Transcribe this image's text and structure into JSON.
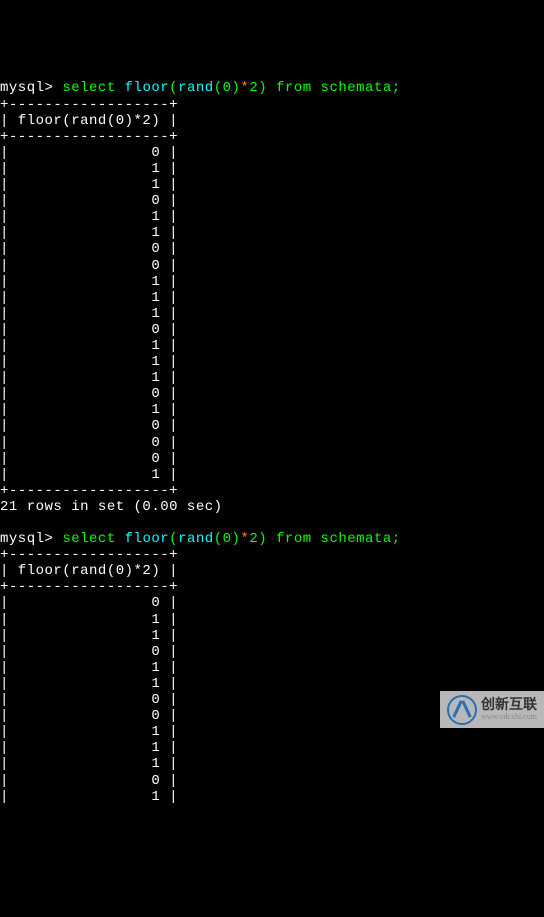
{
  "query1": {
    "prompt": "mysql>",
    "sql_select": "select",
    "sql_floor": "floor",
    "sql_rand": "rand",
    "sql_zero": "0",
    "sql_two": "2",
    "sql_from": "from",
    "sql_table": "schemata",
    "border": "+------------------+",
    "header": "| floor(rand(0)*2) |",
    "rows": [
      "|                0 |",
      "|                1 |",
      "|                1 |",
      "|                0 |",
      "|                1 |",
      "|                1 |",
      "|                0 |",
      "|                0 |",
      "|                1 |",
      "|                1 |",
      "|                1 |",
      "|                0 |",
      "|                1 |",
      "|                1 |",
      "|                1 |",
      "|                0 |",
      "|                1 |",
      "|                0 |",
      "|                0 |",
      "|                0 |",
      "|                1 |"
    ],
    "status": "21 rows in set (0.00 sec)"
  },
  "query2": {
    "prompt": "mysql>",
    "sql_select": "select",
    "sql_floor": "floor",
    "sql_rand": "rand",
    "sql_zero": "0",
    "sql_two": "2",
    "sql_from": "from",
    "sql_table": "schemata",
    "border": "+------------------+",
    "header": "| floor(rand(0)*2) |",
    "rows": [
      "|                0 |",
      "|                1 |",
      "|                1 |",
      "|                0 |",
      "|                1 |",
      "|                1 |",
      "|                0 |",
      "|                0 |",
      "|                1 |",
      "|                1 |",
      "|                1 |",
      "|                0 |",
      "|                1 |"
    ]
  },
  "logo": {
    "text_main": "创新互联",
    "text_sub": "www.cdcxhl.com"
  }
}
